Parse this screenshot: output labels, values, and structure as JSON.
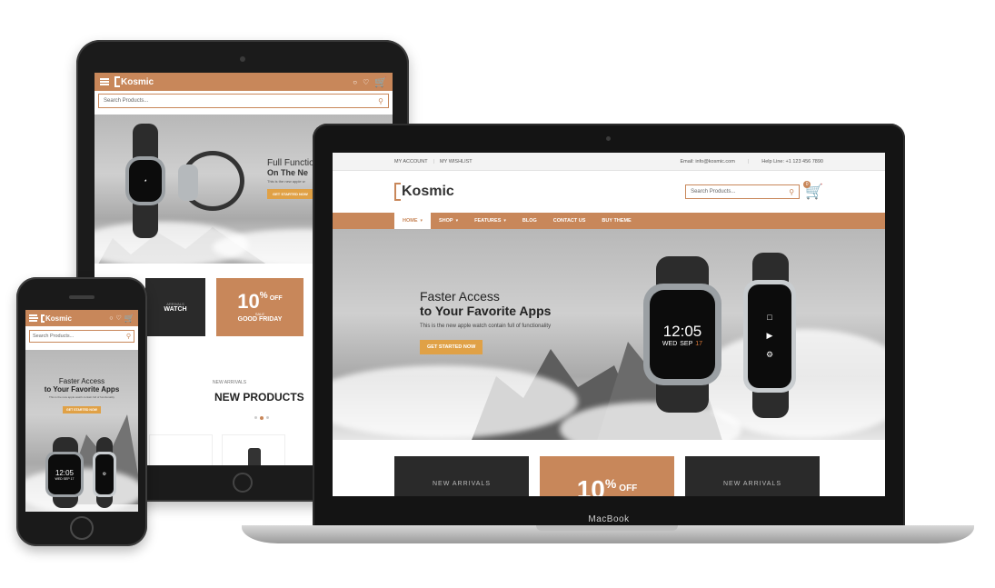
{
  "colors": {
    "brand": "#c8875a",
    "button": "#e0a146",
    "device_frame": "#1b1b1b"
  },
  "tablet": {
    "logo": "Kosmic",
    "search_placeholder": "Search Products...",
    "cart_count": "0",
    "hero": {
      "title_line1": "Full Functio",
      "title_line2": "On The Ne",
      "subtitle": "This is the new apple w",
      "cta": "GET STARTED NOW"
    },
    "promo_left": "WATCH",
    "promo_left_sub": "ARRIVALS",
    "promo_center": {
      "big": "10",
      "pct": "%",
      "off": "OFF",
      "sale": "SALE",
      "label": "GOOD FRIDAY"
    },
    "section_small": "NEW ARRIVALS",
    "section_title": "NEW PRODUCTS"
  },
  "laptop": {
    "brand": "MacBook",
    "topbar": {
      "account": "MY ACCOUNT",
      "wishlist": "MY WISHLIST",
      "email": "Email: info@kosmic.com",
      "helpline": "Help Line: +1 123 456 7890"
    },
    "logo": "Kosmic",
    "search_placeholder": "Search Products...",
    "cart_count": "0",
    "nav": [
      "HOME",
      "SHOP",
      "FEATURES",
      "BLOG",
      "CONTACT US",
      "BUY THEME"
    ],
    "hero": {
      "title_line1": "Faster Access",
      "title_line2": "to Your Favorite Apps",
      "subtitle": "This is the new apple watch contain full of functionality",
      "cta": "GET STARTED NOW",
      "watch_time": "12:05",
      "watch_day": "WED",
      "watch_month": "SEP",
      "watch_date": "17"
    },
    "promo_left": "NEW ARRIVALS",
    "promo_center": {
      "big": "10",
      "pct": "%",
      "off": "OFF"
    },
    "promo_right": "NEW ARRIVALS"
  },
  "phone": {
    "logo": "Kosmic",
    "search_placeholder": "Search Products...",
    "cart_count": "0",
    "hero": {
      "title_line1": "Faster Access",
      "title_line2": "to Your Favorite Apps",
      "subtitle": "This is the new apple watch contain full of functionality",
      "cta": "GET STARTED NOW",
      "watch_time": "12:05",
      "watch_date": "WED SEP 17"
    }
  }
}
